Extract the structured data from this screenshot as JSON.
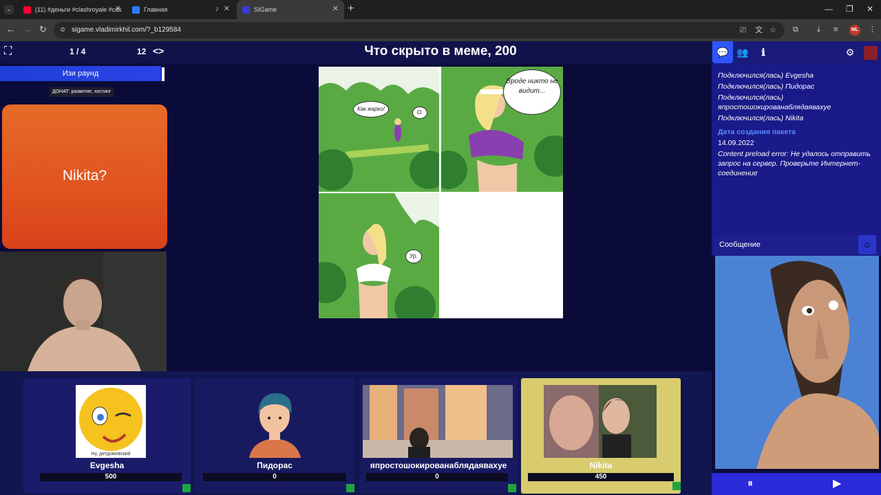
{
  "browser": {
    "tabs": [
      {
        "title": "(11) #деньги #clashroyale #cas",
        "favicon_color": "#ff0033"
      },
      {
        "title": "Главная",
        "favicon_color": "#2d7cf6"
      },
      {
        "title": "SIGame",
        "favicon_color": "#3a3ad0"
      }
    ],
    "url": "sigame.vladimirkhil.com/?_b129584",
    "profile_initials": "ML"
  },
  "game": {
    "round_progress": "1 / 4",
    "timer": "12",
    "code_toggle": "<>",
    "question_title": "Что скрыто в меме, 200",
    "round_name": "Изи раунд",
    "donate": "ДОНАТ: развитие, хостинг",
    "answer": "Nikita?"
  },
  "meme": {
    "bubbles": [
      "Как жарко!",
      "О.",
      "Вроде никто не видит...",
      "Ур."
    ]
  },
  "players": [
    {
      "name": "Evgesha",
      "score": "500",
      "avatar_caption": "Ну, детдомовский"
    },
    {
      "name": "Пидорас",
      "score": "0"
    },
    {
      "name": "япростошокированаблядаявахуе",
      "score": "0"
    },
    {
      "name": "Nikita",
      "score": "450"
    }
  ],
  "sidebar": {
    "chat": [
      {
        "text": "Подключился(лась) Evgesha",
        "kind": "info"
      },
      {
        "text": "Подключился(лась) Пидорас",
        "kind": "info"
      },
      {
        "text": "Подключился(лась) япростошокированаблядаявахуе",
        "kind": "info"
      },
      {
        "text": "Подключился(лась) Nikita",
        "kind": "info"
      },
      {
        "text": "Дата создания пакета",
        "kind": "header"
      },
      {
        "text": "14.09.2022",
        "kind": "plain"
      },
      {
        "text": "Content preload error: Не удалось отправить запрос на сервер. Проверьте Интернет-соединение",
        "kind": "info"
      }
    ],
    "message_placeholder": "Сообщение"
  },
  "colors": {
    "answer_card": "#e15520",
    "active_player": "#d8cc6e",
    "chat_header": "#5b8cff"
  }
}
